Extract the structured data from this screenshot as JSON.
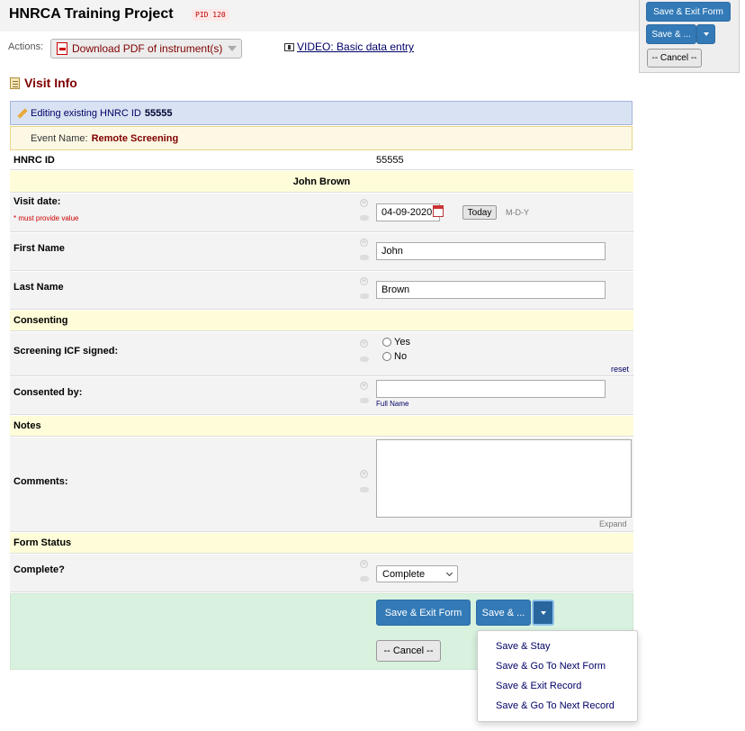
{
  "header": {
    "project_title": "HNRCA Training Project",
    "pid_badge": "PID 120",
    "actions_label": "Actions:",
    "download_pdf_label": "Download PDF of instrument(s)",
    "video_link_label": "VIDEO: Basic data entry"
  },
  "floating_panel": {
    "save_exit_label": "Save & Exit Form",
    "save_more_label": "Save & ...",
    "cancel_label": "-- Cancel --"
  },
  "form": {
    "title": "Visit Info",
    "editing_prefix": "Editing existing HNRC ID",
    "record_id": "55555",
    "event_label": "Event Name:",
    "event_name": "Remote Screening"
  },
  "fields": {
    "hnrc_id_label": "HNRC ID",
    "hnrc_id_value": "55555",
    "name_banner": "John Brown",
    "visit_date_label": "Visit date:",
    "required_note": "* must provide value",
    "visit_date_value": "04-09-2020",
    "today_label": "Today",
    "date_format": "M-D-Y",
    "first_name_label": "First Name",
    "first_name_value": "John",
    "last_name_label": "Last Name",
    "last_name_value": "Brown",
    "consenting_header": "Consenting",
    "icf_label": "Screening ICF signed:",
    "radio_yes": "Yes",
    "radio_no": "No",
    "reset_label": "reset",
    "consented_by_label": "Consented by:",
    "consented_by_value": "",
    "full_name_hint": "Full Name",
    "notes_header": "Notes",
    "comments_label": "Comments:",
    "expand_label": "Expand",
    "form_status_header": "Form Status",
    "complete_label": "Complete?",
    "complete_value": "Complete",
    "history_icon_glyph": "H"
  },
  "actions": {
    "save_exit_label": "Save & Exit Form",
    "save_more_label": "Save & ...",
    "cancel_label": "-- Cancel --"
  },
  "dropdown_menu": {
    "items": [
      "Save & Stay",
      "Save & Go To Next Form",
      "Save & Exit Record",
      "Save & Go To Next Record"
    ]
  },
  "colors": {
    "accent_blue": "#337ab7",
    "form_title": "#800000",
    "header_row": "#fffdd9",
    "save_zone": "#d9f2df"
  }
}
